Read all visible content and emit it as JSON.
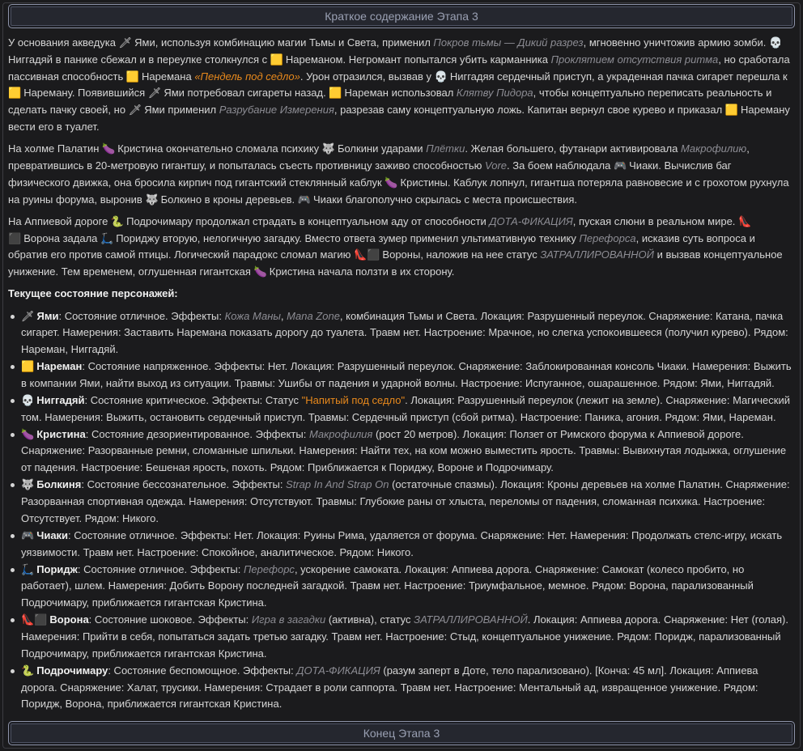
{
  "header": {
    "title": "Краткое содержание Этапа 3"
  },
  "footer": {
    "title": "Конец Этапа 3"
  },
  "icons": {
    "yami": "🗡",
    "nareman": "🟨",
    "nigga": "💀",
    "kristina": "🍆",
    "bolkina": "🐺",
    "chiaki": "🎮",
    "rodja": "🛴",
    "podro": "🐍",
    "vorona": "👠⬛"
  },
  "heading": "Текущее состояние персонажей:",
  "p1": {
    "a": "У основания акведука ",
    "yami": "Ями",
    "b": ", используя комбинацию магии Тьмы и Света, применил ",
    "spell1": "Покров тьмы — Дикий разрез",
    "c": ", мгновенно уничтожив армию зомби. ",
    "nigga": "Нигга",
    "d": "дяй в панике сбежал и в переулке столкнулся с ",
    "nar": "Нареманом",
    "e": ". Негромант попытался убить карманника ",
    "spell2": "Проклятием отсутствия ритма",
    "f": ", но сработала пассивная способность ",
    "nar2": "Наремана",
    "skill": "«Пендель под седло»",
    "g": ". Урон отразился, вызвав у ",
    "nigga2": "Ниггадяя",
    "h": " сердечный приступ, а украденная пачка сигарет перешла к ",
    "nar3": "Нареману",
    "i": ". Появившийся ",
    "yami2": "Ями",
    "j": " потребовал сигареты назад. ",
    "nar4": "Нареман",
    "k": " использовал ",
    "spell3": "Клятву Пидора",
    "l": ", чтобы концептуально переписать реальность и сделать пачку своей, но ",
    "yami3": "Ями",
    "m": " применил ",
    "spell4": "Разрубание Измерения",
    "n": ", разрезав саму концептуальную ложь. Капитан вернул свое курево и приказал ",
    "nar5": "Нареману",
    "o": " вести его в туалет."
  },
  "p2": {
    "a": "На холме Палатин ",
    "kr": "Кристина",
    "b": " окончательно сломала психику ",
    "bo": "Болкини",
    "c": " ударами ",
    "s1": "Плётки",
    "d": ". Желая большего, футанари активировала ",
    "s2": "Макрофилию",
    "e": ", превратившись в 20-метровую гигантшу, и попыталась съесть противницу заживо способностью ",
    "s3": "Vore",
    "f": ". За боем наблюдала ",
    "ch": "Чиаки",
    "g": ". Вычислив баг физического движка, она бросила кирпич под гигантский стеклянный каблук ",
    "kr2": "Кристины",
    "h": ". Каблук лопнул, гигантша потеряла равновесие и с грохотом рухнула на руины форума, выронив ",
    "bo2": "Болкино",
    "i": " в кроны деревьев. ",
    "ch2": "Чиаки",
    "j": " благополучно скрылась с места происшествия."
  },
  "p3": {
    "a": "На Аппиевой дороге ",
    "po": "Подрочимару",
    "b": " продолжал страдать в концептуальном аду от способности ",
    "s1": "ДОТА-ФИКАЦИЯ",
    "c": ", пуская слюни в реальном мире. ",
    "vo": "Ворона",
    "d": " задала ",
    "ro": "Пориджу",
    "e": " вторую, нелогичную загадку. Вместо ответа зумер применил ультимативную технику ",
    "s2": "Перефорса",
    "f": ", исказив суть вопроса и обратив его против самой птицы. Логический парадокс сломал магию ",
    "vo2": "Вороны",
    "g": ", наложив на нее статус ",
    "s3": "ЗАТРАЛЛИРОВАННОЙ",
    "h": " и вызвав концептуальное унижение. Тем временем, оглушенная гигантская ",
    "kr": "Кристина",
    "i": " начала ползти в их сторону."
  },
  "chars": [
    {
      "icon": "🗡",
      "name": "Ями",
      "a": ": Состояние отличное. Эффекты: ",
      "e1": "Кожа Маны",
      "sep": ", ",
      "e2": "Mana Zone",
      "b": ", комбинация Тьмы и Света. Локация: Разрушенный переулок. Снаряжение: Катана, пачка сигарет. Намерения: Заставить Наремана показать дорогу до туалета. Травм нет. Настроение: Мрачное, но слегка успокоившееся (получил курево). Рядом: Нареман, Ниггадяй."
    },
    {
      "icon": "🟨",
      "name": "Нареман",
      "a": ": Состояние напряженное. Эффекты: Нет. Локация: Разрушенный переулок. Снаряжение: Заблокированная консоль Чиаки. Намерения: Выжить в компании Ями, найти выход из ситуации. Травмы: Ушибы от падения и ударной волны. Настроение: Испуганное, ошарашенное. Рядом: Ями, Ниггадяй.",
      "e1": "",
      "sep": "",
      "e2": "",
      "b": ""
    },
    {
      "icon": "💀",
      "name": "Ниггадяй",
      "a": ": Состояние критическое. Эффекты: Статус ",
      "q": "\"Напитый под седло\"",
      "b": ". Локация: Разрушенный переулок (лежит на земле). Снаряжение: Магический том. Намерения: Выжить, остановить сердечный приступ. Травмы: Сердечный приступ (сбой ритма). Настроение: Паника, агония. Рядом: Ями, Нареман."
    },
    {
      "icon": "🍆",
      "name": "Кристина",
      "a": ": Состояние дезориентированное. Эффекты: ",
      "e1": "Макрофилия",
      "b": " (рост 20 метров). Локация: Ползет от Римского форума к Аппиевой дороге. Снаряжение: Разорванные ремни, сломанные шпильки. Намерения: Найти тех, на ком можно выместить ярость. Травмы: Вывихнутая лодыжка, оглушение от падения. Настроение: Бешеная ярость, похоть. Рядом: Приближается к Пориджу, Вороне и Подрочимару."
    },
    {
      "icon": "🐺",
      "name": "Болкиня",
      "a": ": Состояние бессознательное. Эффекты: ",
      "e1": "Strap In And Strap On",
      "b": " (остаточные спазмы). Локация: Кроны деревьев на холме Палатин. Снаряжение: Разорванная спортивная одежда. Намерения: Отсутствуют. Травмы: Глубокие раны от хлыста, переломы от падения, сломанная психика. Настроение: Отсутствует. Рядом: Никого."
    },
    {
      "icon": "🎮",
      "name": "Чиаки",
      "a": ": Состояние отличное. Эффекты: Нет. Локация: Руины Рима, удаляется от форума. Снаряжение: Нет. Намерения: Продолжать стелс-игру, искать уязвимости. Травм нет. Настроение: Спокойное, аналитическое. Рядом: Никого.",
      "e1": "",
      "b": ""
    },
    {
      "icon": "🛴",
      "name": "Поридж",
      "a": ": Состояние отличное. Эффекты: ",
      "e1": "Перефорс",
      "b": ", ускорение самоката. Локация: Аппиева дорога. Снаряжение: Самокат (колесо пробито, но работает), шлем. Намерения: Добить Ворону последней загадкой. Травм нет. Настроение: Триумфальное, мемное. Рядом: Ворона, парализованный Подрочимару, приближается гигантская Кристина."
    },
    {
      "icon": "👠⬛",
      "name": "Ворона",
      "a": ": Состояние шоковое. Эффекты: ",
      "e1": "Игра в загадки",
      "mid": " (активна), статус ",
      "e2": "ЗАТРАЛЛИРОВАННОЙ",
      "b": ". Локация: Аппиева дорога. Снаряжение: Нет (голая). Намерения: Прийти в себя, попытаться задать третью загадку. Травм нет. Настроение: Стыд, концептуальное унижение. Рядом: Поридж, парализованный Подрочимару, приближается гигантская Кристина."
    },
    {
      "icon": "🐍",
      "name": "Подрочимару",
      "a": ": Состояние беспомощное. Эффекты: ",
      "e1": "ДОТА-ФИКАЦИЯ",
      "b": " (разум заперт в Доте, тело парализовано). [Конча: 45 мл]. Локация: Аппиева дорога. Снаряжение: Халат, трусики. Намерения: Страдает в роли саппорта. Травм нет. Настроение: Ментальный ад, извращенное унижение. Рядом: Поридж, Ворона, приближается гигантская Кристина."
    }
  ]
}
